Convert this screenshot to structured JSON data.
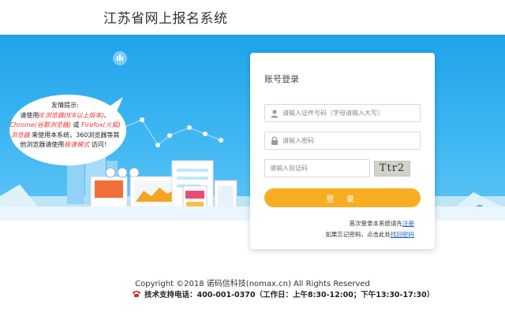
{
  "header": {
    "title": "江苏省网上报名系统"
  },
  "notice": {
    "title": "友情提示:",
    "line_a": "请使用",
    "ie": "IE浏览器(IE8以上版本)",
    "sep1": "、",
    "chrome": "Chrome(谷歌浏览器)",
    "or": "或",
    "firefox": "Firefox(火狐)浏览器",
    "use_system": "来使用本系统，360浏览器等其他浏览器请使用",
    "speed": "极速模式",
    "visit": "访问！"
  },
  "login": {
    "title": "账号登录",
    "id_placeholder": "请输入证件号码（字母请输入大写）",
    "password_placeholder": "请输入密码",
    "captcha_placeholder": "请输入验证码",
    "captcha_text": "Ttr2",
    "submit_label": "登 录",
    "register_prefix": "首次登录本系统请先",
    "register_link": "注册",
    "forgot_prefix": "如果忘记密码，点击此处",
    "forgot_link": "找回密码"
  },
  "footer": {
    "copyright": "Copyright ©2018 诺码信科技(nomax.cn) All Rights Reserved",
    "support": "技术支持电话：400-001-0370（工作日：上午8:30-12:00；下午13:30-17:30）"
  },
  "colors": {
    "banner": "#1ea3ea",
    "button": "#f8ae22",
    "link": "#1e66c8",
    "notice_red": "#e53935"
  }
}
